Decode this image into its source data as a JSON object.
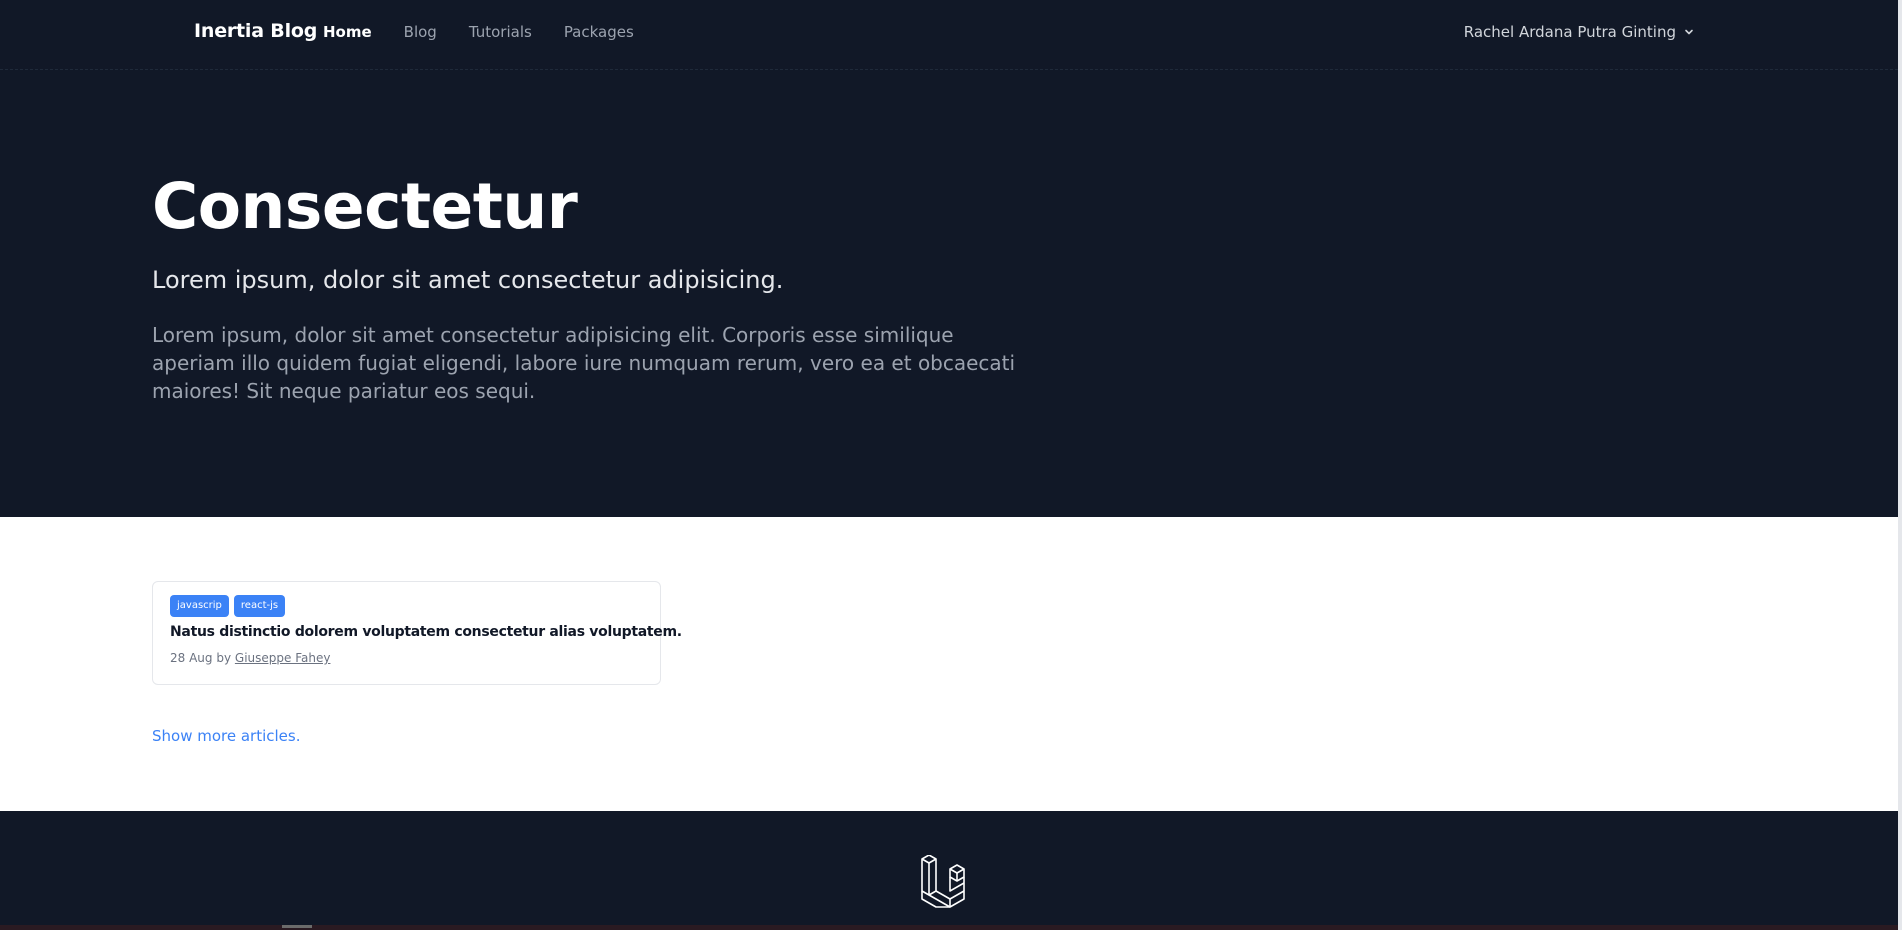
{
  "nav": {
    "brand": "Inertia Blog",
    "links": [
      {
        "label": "Home",
        "active": true
      },
      {
        "label": "Blog",
        "active": false
      },
      {
        "label": "Tutorials",
        "active": false
      },
      {
        "label": "Packages",
        "active": false
      }
    ],
    "user_name": "Rachel Ardana Putra Ginting",
    "user_menu_icon": "chevron-down-icon"
  },
  "hero": {
    "title": "Consectetur",
    "subtitle": "Lorem ipsum, dolor sit amet consectetur adipisicing.",
    "lead": "Lorem ipsum, dolor sit amet consectetur adipisicing elit. Corporis esse similique aperiam illo quidem fugiat eligendi, labore iure numquam rerum, vero ea et obcaecati maiores! Sit neque pariatur eos sequi."
  },
  "articles": [
    {
      "tags": [
        "javascrip",
        "react-js"
      ],
      "title": "Natus distinctio dolorem voluptatem consectetur alias voluptatem.",
      "date": "28 Aug",
      "by": "by",
      "author": "Giuseppe Fahey"
    }
  ],
  "show_more": "Show more articles.",
  "footer": {
    "logo_icon": "laravel-logo-icon"
  },
  "colors": {
    "dark_bg": "#111827",
    "accent": "#3b82f6",
    "white": "#ffffff"
  }
}
